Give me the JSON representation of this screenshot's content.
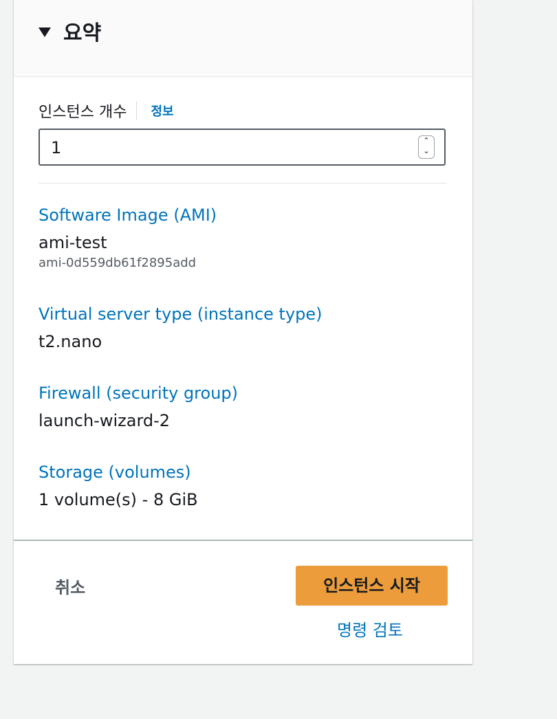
{
  "header": {
    "title": "요약"
  },
  "instance_count": {
    "label": "인스턴스 개수",
    "info_link": "정보",
    "value": "1"
  },
  "summary": [
    {
      "title": "Software Image (AMI)",
      "value": "ami-test",
      "sub": "ami-0d559db61f2895add"
    },
    {
      "title": "Virtual server type (instance type)",
      "value": "t2.nano"
    },
    {
      "title": "Firewall (security group)",
      "value": "launch-wizard-2"
    },
    {
      "title": "Storage (volumes)",
      "value": "1 volume(s) - 8 GiB"
    }
  ],
  "footer": {
    "cancel_label": "취소",
    "launch_label": "인스턴스 시작",
    "review_label": "명령 검토"
  },
  "colors": {
    "accent": "#ec9c3b",
    "link": "#0073bb"
  }
}
